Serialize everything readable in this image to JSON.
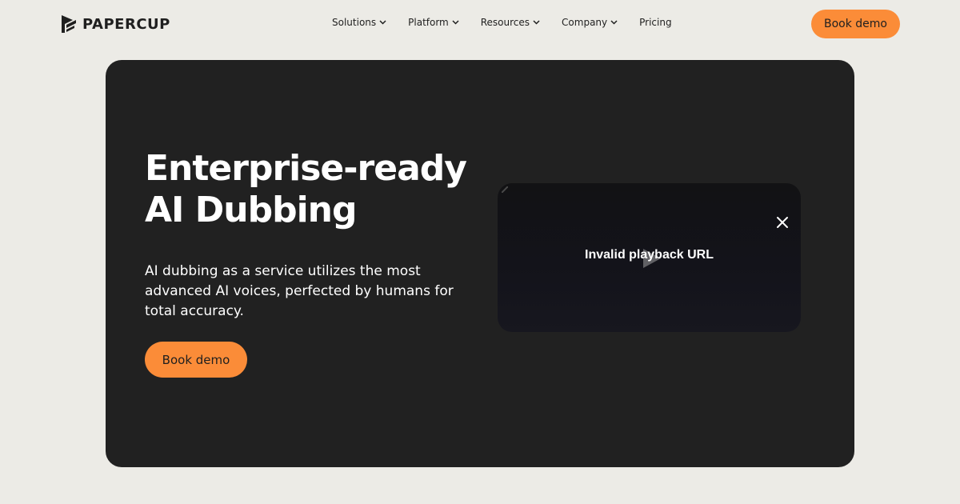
{
  "brand": {
    "name": "PAPERCUP",
    "logo_icon": "papercup-logo-icon",
    "accent_color": "#fb8c38"
  },
  "nav": {
    "items": [
      {
        "label": "Solutions",
        "has_dropdown": true
      },
      {
        "label": "Platform",
        "has_dropdown": true
      },
      {
        "label": "Resources",
        "has_dropdown": true
      },
      {
        "label": "Company",
        "has_dropdown": true
      },
      {
        "label": "Pricing",
        "has_dropdown": false
      }
    ],
    "cta_label": "Book demo"
  },
  "hero": {
    "title_line1": "Enterprise-ready",
    "title_line2": "AI Dubbing",
    "subtitle": "AI dubbing as a service utilizes the most advanced AI voices, perfected by humans for total accuracy.",
    "cta_label": "Book demo",
    "background_color": "#212121"
  },
  "video": {
    "error_message": "Invalid playback URL",
    "close_icon": "close-icon",
    "play_icon": "play-icon"
  }
}
